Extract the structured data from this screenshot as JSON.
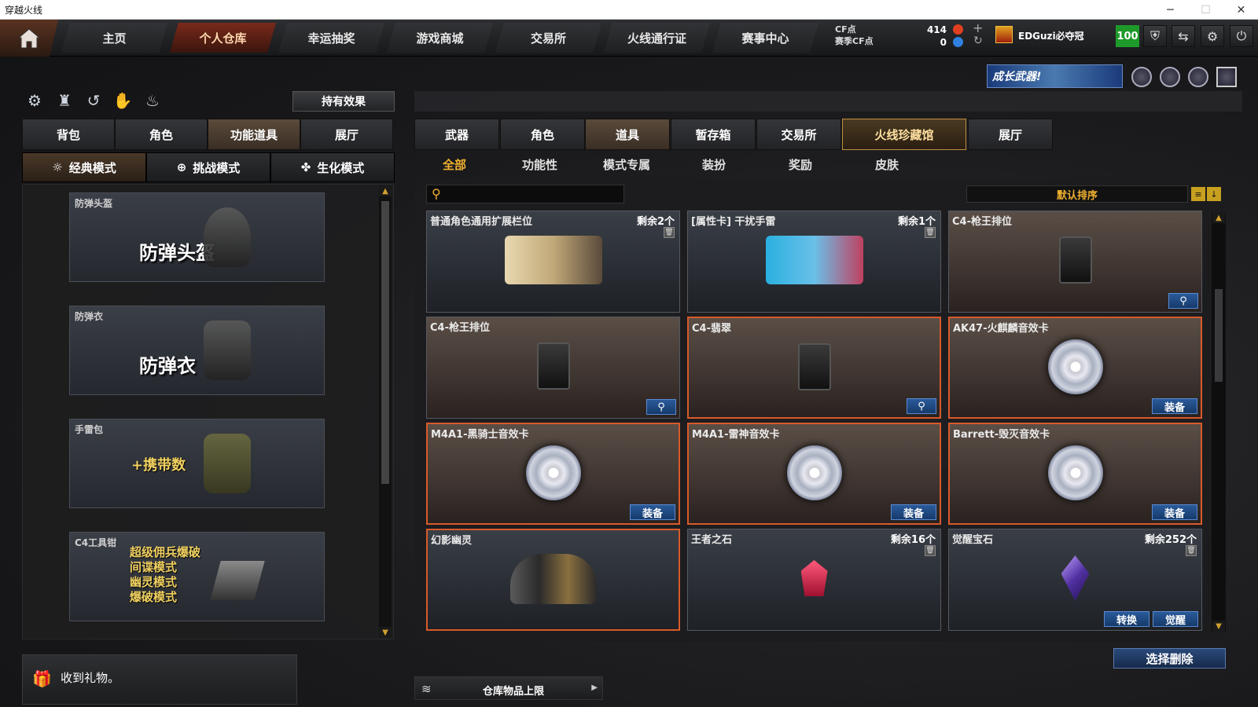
{
  "window": {
    "title": "穿越火线"
  },
  "nav": {
    "tabs": [
      "主页",
      "个人仓库",
      "幸运抽奖",
      "游戏商城",
      "交易所",
      "火线通行证",
      "赛事中心"
    ],
    "active": 1
  },
  "currency": {
    "cf_label": "CF点",
    "cf_value": "414",
    "match_cf_label": "赛季CF点",
    "match_cf_value": "0"
  },
  "user": {
    "name": "EDGuzi必夺冠",
    "level": "100"
  },
  "banner": {
    "text": "成长武器!"
  },
  "left": {
    "hold_effect_label": "持有效果",
    "tabs": [
      "背包",
      "角色",
      "功能道具",
      "展厅"
    ],
    "active_tab": 2,
    "modes": [
      "经典模式",
      "挑战模式",
      "生化模式"
    ],
    "active_mode": 0,
    "cards": [
      {
        "label": "防弹头盔",
        "big": "防弹头盔"
      },
      {
        "label": "防弹衣",
        "big": "防弹衣"
      },
      {
        "label": "手雷包",
        "big": "+携带数"
      },
      {
        "label": "C4工具钳",
        "lines": [
          "超级佣兵爆破",
          "间谍模式",
          "幽灵模式",
          "爆破模式"
        ]
      }
    ],
    "gift_text": "收到礼物。"
  },
  "right": {
    "tabs": [
      "武器",
      "角色",
      "道具",
      "暂存箱",
      "交易所",
      "火线珍藏馆",
      "展厅"
    ],
    "active_tab": 2,
    "sub_tabs": [
      "全部",
      "功能性",
      "模式专属",
      "装扮",
      "奖励",
      "皮肤"
    ],
    "active_sub": 0,
    "search_placeholder": "",
    "sort_label": "默认排序",
    "items": [
      {
        "name": "普通角色通用扩展栏位",
        "remaining": "剩余2个",
        "trash": true,
        "art": "key"
      },
      {
        "name": "[属性卡] 干扰手雷",
        "remaining": "剩余1个",
        "trash": true,
        "art": "card"
      },
      {
        "name": "C4-枪王排位",
        "remaining": "",
        "art": "c4",
        "zoom": true
      },
      {
        "name": "C4-枪王排位",
        "remaining": "",
        "art": "c4",
        "zoom": true
      },
      {
        "name": "C4-翡翠",
        "remaining": "",
        "art": "c4",
        "zoom": true,
        "hl": true
      },
      {
        "name": "AK47-火麒麟音效卡",
        "remaining": "",
        "art": "cd",
        "btn": "装备",
        "hl": true
      },
      {
        "name": "M4A1-黑骑士音效卡",
        "remaining": "",
        "art": "cd",
        "btn": "装备",
        "hl": true
      },
      {
        "name": "M4A1-雷神音效卡",
        "remaining": "",
        "art": "cd",
        "btn": "装备",
        "hl": true
      },
      {
        "name": "Barrett-毁灭音效卡",
        "remaining": "",
        "art": "cd",
        "btn": "装备",
        "hl": true
      },
      {
        "name": "幻影幽灵",
        "remaining": "",
        "art": "ghost",
        "hl": true
      },
      {
        "name": "王者之石",
        "remaining": "剩余16个",
        "trash": true,
        "art": "ruby"
      },
      {
        "name": "觉醒宝石",
        "remaining": "剩余252个",
        "trash": true,
        "art": "gem",
        "btn2": [
          "转换",
          "觉醒"
        ]
      }
    ],
    "delete_label": "选择删除",
    "capacity_label": "仓库物品上限"
  },
  "colors": {
    "accent": "#f0b030",
    "highlight": "#d85a2a",
    "level_green": "#1e9a2a"
  }
}
